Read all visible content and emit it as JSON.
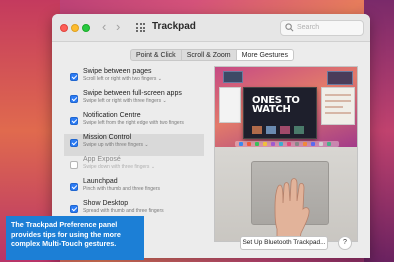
{
  "window": {
    "title": "Trackpad",
    "search_placeholder": "Search"
  },
  "tabs": [
    {
      "label": "Point & Click",
      "active": false
    },
    {
      "label": "Scroll & Zoom",
      "active": false
    },
    {
      "label": "More Gestures",
      "active": true
    }
  ],
  "options": [
    {
      "title": "Swipe between pages",
      "subtitle": "Scroll left or right with two fingers ⌄",
      "checked": true,
      "highlight": false,
      "disabled": false
    },
    {
      "title": "Swipe between full-screen apps",
      "subtitle": "Swipe left or right with three fingers ⌄",
      "checked": true,
      "highlight": false,
      "disabled": false
    },
    {
      "title": "Notification Centre",
      "subtitle": "Swipe left from the right edge with two fingers",
      "checked": true,
      "highlight": false,
      "disabled": false
    },
    {
      "title": "Mission Control",
      "subtitle": "Swipe up with three fingers ⌄",
      "checked": true,
      "highlight": true,
      "disabled": false
    },
    {
      "title": "App Exposé",
      "subtitle": "Swipe down with three fingers ⌄",
      "checked": false,
      "highlight": false,
      "disabled": true
    },
    {
      "title": "Launchpad",
      "subtitle": "Pinch with thumb and three fingers",
      "checked": true,
      "highlight": false,
      "disabled": false
    },
    {
      "title": "Show Desktop",
      "subtitle": "Spread with thumb and three fingers",
      "checked": true,
      "highlight": false,
      "disabled": false
    }
  ],
  "preview": {
    "headline_line1": "ONES TO",
    "headline_line2": "WATCH"
  },
  "buttons": {
    "bluetooth": "Set Up Bluetooth Trackpad...",
    "help": "?"
  },
  "caption": {
    "line1": "The Trackpad Preference panel",
    "line2": "provides tips for using the more",
    "line3": "complex Multi-Touch gestures."
  },
  "colors": {
    "accent": "#2b7bf4",
    "caption_bg": "#1c7fd6"
  },
  "icons": {
    "close": "close-dot",
    "minimize": "minimize-dot",
    "zoom": "zoom-dot",
    "back": "chevron-left-icon",
    "forward": "chevron-right-icon",
    "grid": "grid-icon",
    "search": "search-icon"
  }
}
